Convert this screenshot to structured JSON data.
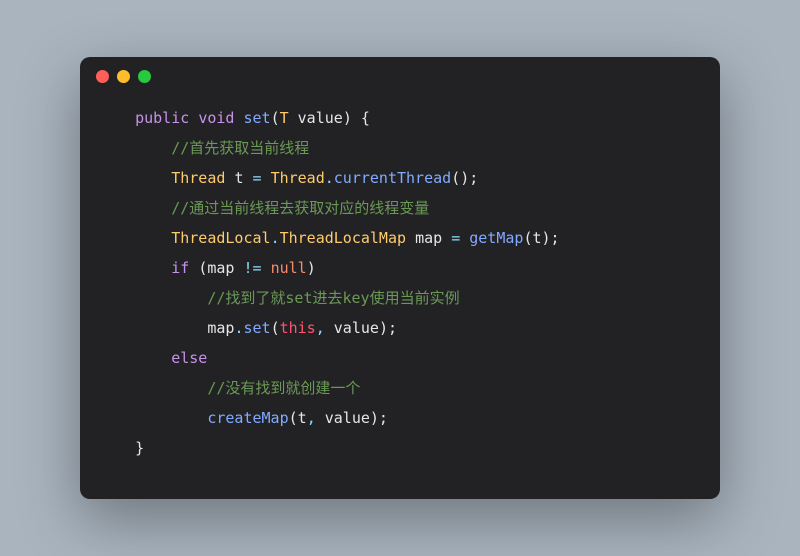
{
  "code": {
    "sig": {
      "modifier": "public",
      "returnType": "void",
      "name": "set",
      "paramType": "T",
      "paramName": "value"
    },
    "c1": "//首先获取当前线程",
    "l2": {
      "type": "Thread",
      "var": "t",
      "eq": "=",
      "cls": "Thread",
      "dot": ".",
      "method": "currentThread",
      "tail": "();"
    },
    "c2": "//通过当前线程去获取对应的线程变量",
    "l4": {
      "type1": "ThreadLocal",
      "dot1": ".",
      "type2": "ThreadLocalMap",
      "var": "map",
      "eq": "=",
      "method": "getMap",
      "open": "(",
      "arg": "t",
      "close": ");"
    },
    "l5": {
      "kw": "if",
      "open": "(",
      "var": "map",
      "op": "!=",
      "nulllit": "null",
      "close": ")"
    },
    "c3": "//找到了就set进去key使用当前实例",
    "l7": {
      "obj": "map",
      "dot": ".",
      "method": "set",
      "open": "(",
      "thiskw": "this",
      "comma": ",",
      "arg2": "value",
      "close": ");"
    },
    "l8": {
      "kw": "else"
    },
    "c4": "//没有找到就创建一个",
    "l10": {
      "method": "createMap",
      "open": "(",
      "arg1": "t",
      "comma": ",",
      "arg2": "value",
      "close": ");"
    },
    "closeBrace": "}"
  }
}
